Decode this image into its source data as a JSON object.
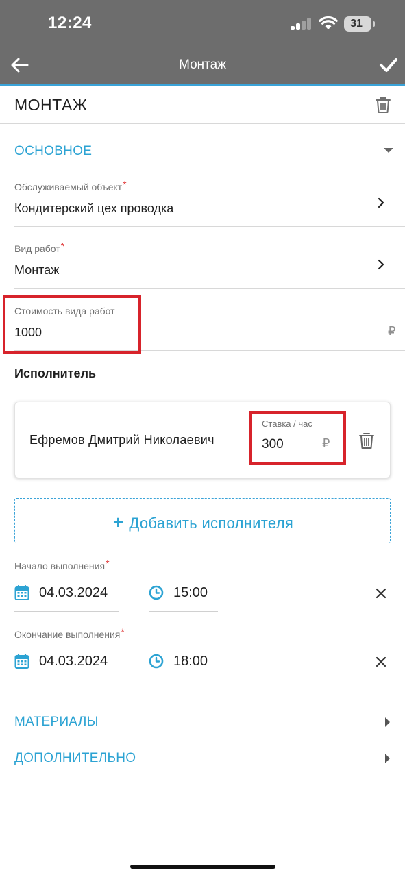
{
  "status_bar": {
    "time": "12:24",
    "battery": "31"
  },
  "nav": {
    "title": "Монтаж",
    "back_icon": "arrow-left-icon",
    "confirm_icon": "checkmark-icon"
  },
  "header": {
    "title": "МОНТАЖ",
    "delete_icon": "trash-icon"
  },
  "basic_section": {
    "title": "ОСНОВНОЕ",
    "service_object": {
      "label": "Обслуживаемый объект",
      "required_mark": "*",
      "value": "Кондитерский цех проводка"
    },
    "work_type": {
      "label": "Вид работ",
      "required_mark": "*",
      "value": "Монтаж"
    },
    "work_cost": {
      "label": "Стоимость вида работ",
      "value": "1000",
      "currency": "₽"
    }
  },
  "executor_section": {
    "title": "Исполнитель",
    "executor": {
      "name": "Ефремов Дмитрий Николаевич",
      "rate_label": "Ставка / час",
      "rate_value": "300",
      "currency": "₽"
    },
    "add_button": {
      "plus": "+",
      "label": "Добавить исполнителя"
    }
  },
  "schedule": {
    "start": {
      "label": "Начало выполнения",
      "required_mark": "*",
      "date": "04.03.2024",
      "time": "15:00"
    },
    "end": {
      "label": "Окончание выполнения",
      "required_mark": "*",
      "date": "04.03.2024",
      "time": "18:00"
    }
  },
  "collapsed_sections": {
    "materials": "МАТЕРИАЛЫ",
    "additional": "ДОПОЛНИТЕЛЬНО"
  },
  "colors": {
    "accent": "#2ca3d3",
    "nav_bg": "#6d6d6d",
    "highlight": "#d7232b",
    "required": "#e03a3a"
  }
}
